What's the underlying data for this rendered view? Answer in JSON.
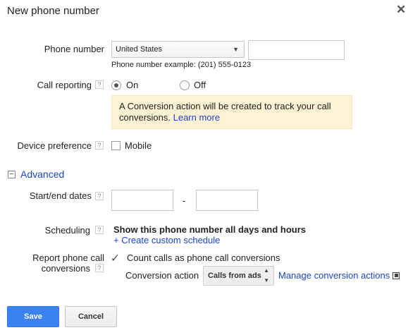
{
  "dialog": {
    "title": "New phone number",
    "close_glyph": "✕"
  },
  "phone": {
    "label": "Phone number",
    "country": "United States",
    "number_value": "",
    "example": "Phone number example: (201) 555-0123"
  },
  "call_reporting": {
    "label": "Call reporting",
    "on_label": "On",
    "off_label": "Off",
    "selected": "On",
    "notice_text": "A Conversion action will be created to track your call conversions.",
    "notice_link": "Learn more"
  },
  "device": {
    "label": "Device preference",
    "mobile_label": "Mobile",
    "mobile_checked": false
  },
  "advanced": {
    "toggle_glyph": "−",
    "label": "Advanced"
  },
  "dates": {
    "label": "Start/end dates",
    "separator": "-",
    "start_value": "",
    "end_value": ""
  },
  "scheduling": {
    "label": "Scheduling",
    "summary": "Show this phone number all days and hours",
    "custom_link": "+ Create custom schedule"
  },
  "report": {
    "label_line1": "Report phone call",
    "label_line2": "conversions",
    "count_label": "Count calls as phone call conversions",
    "count_checked": true,
    "conversion_action_label": "Conversion action",
    "conversion_action_value": "Calls from ads",
    "manage_link": "Manage conversion actions"
  },
  "help_glyph": "?",
  "buttons": {
    "save": "Save",
    "cancel": "Cancel"
  }
}
